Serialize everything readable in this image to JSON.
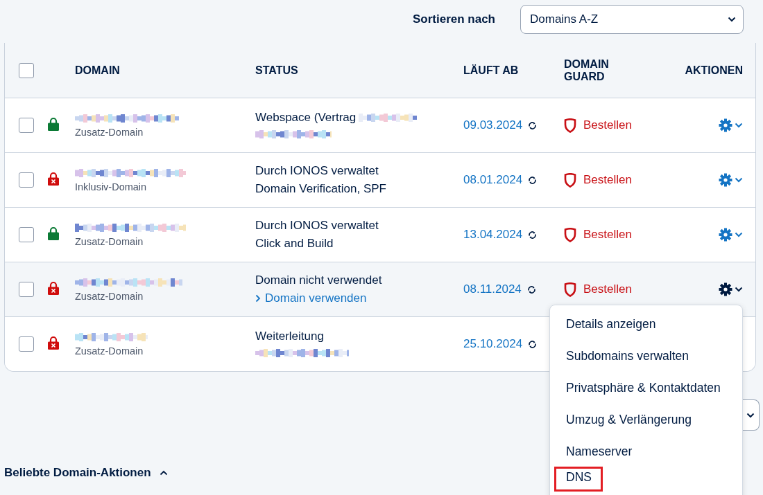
{
  "sort": {
    "label": "Sortieren nach",
    "value": "Domains A-Z"
  },
  "columns": [
    {
      "label": "DOMAIN"
    },
    {
      "label": "STATUS"
    },
    {
      "label": "LÄUFT AB"
    },
    {
      "label": "DOMAIN GUARD"
    },
    {
      "label": "AKTIONEN"
    }
  ],
  "select_all": {
    "checked": false
  },
  "rows": [
    {
      "checked": false,
      "secured": true,
      "domain_type": "Zusatz-Domain",
      "status_lines": [
        {
          "kind": "text",
          "text": "Webspace (Vertrag",
          "masked_tail": true
        },
        {
          "kind": "masked"
        }
      ],
      "expires": "09.03.2024",
      "guard": "Bestellen",
      "menu_open": false
    },
    {
      "checked": false,
      "secured": false,
      "domain_type": "Inklusiv-Domain",
      "status_lines": [
        {
          "kind": "text",
          "text": "Durch IONOS verwaltet"
        },
        {
          "kind": "text",
          "text": "Domain Verification, SPF"
        }
      ],
      "expires": "08.01.2024",
      "guard": "Bestellen",
      "menu_open": false
    },
    {
      "checked": false,
      "secured": true,
      "domain_type": "Zusatz-Domain",
      "status_lines": [
        {
          "kind": "text",
          "text": "Durch IONOS verwaltet"
        },
        {
          "kind": "text",
          "text": "Click and Build"
        }
      ],
      "expires": "13.04.2024",
      "guard": "Bestellen",
      "menu_open": false
    },
    {
      "checked": false,
      "secured": false,
      "domain_type": "Zusatz-Domain",
      "status_lines": [
        {
          "kind": "text",
          "text": "Domain nicht verwendet"
        },
        {
          "kind": "link",
          "text": "Domain verwenden"
        }
      ],
      "expires": "08.11.2024",
      "guard": "Bestellen",
      "menu_open": true
    },
    {
      "checked": false,
      "secured": false,
      "domain_type": "Zusatz-Domain",
      "status_lines": [
        {
          "kind": "text",
          "text": "Weiterleitung"
        },
        {
          "kind": "masked"
        }
      ],
      "expires": "25.10.2024",
      "menu_open": false
    }
  ],
  "menu": [
    {
      "label": "Details anzeigen",
      "highlighted": false
    },
    {
      "label": "Subdomains verwalten",
      "highlighted": false
    },
    {
      "label": "Privatsphäre & Kontaktdaten",
      "highlighted": false
    },
    {
      "label": "Umzug & Verlängerung",
      "highlighted": false
    },
    {
      "label": "Nameserver",
      "highlighted": false
    },
    {
      "label": "DNS",
      "highlighted": true
    }
  ],
  "popular_actions": {
    "label": "Beliebte Domain-Aktionen",
    "expanded": true
  }
}
